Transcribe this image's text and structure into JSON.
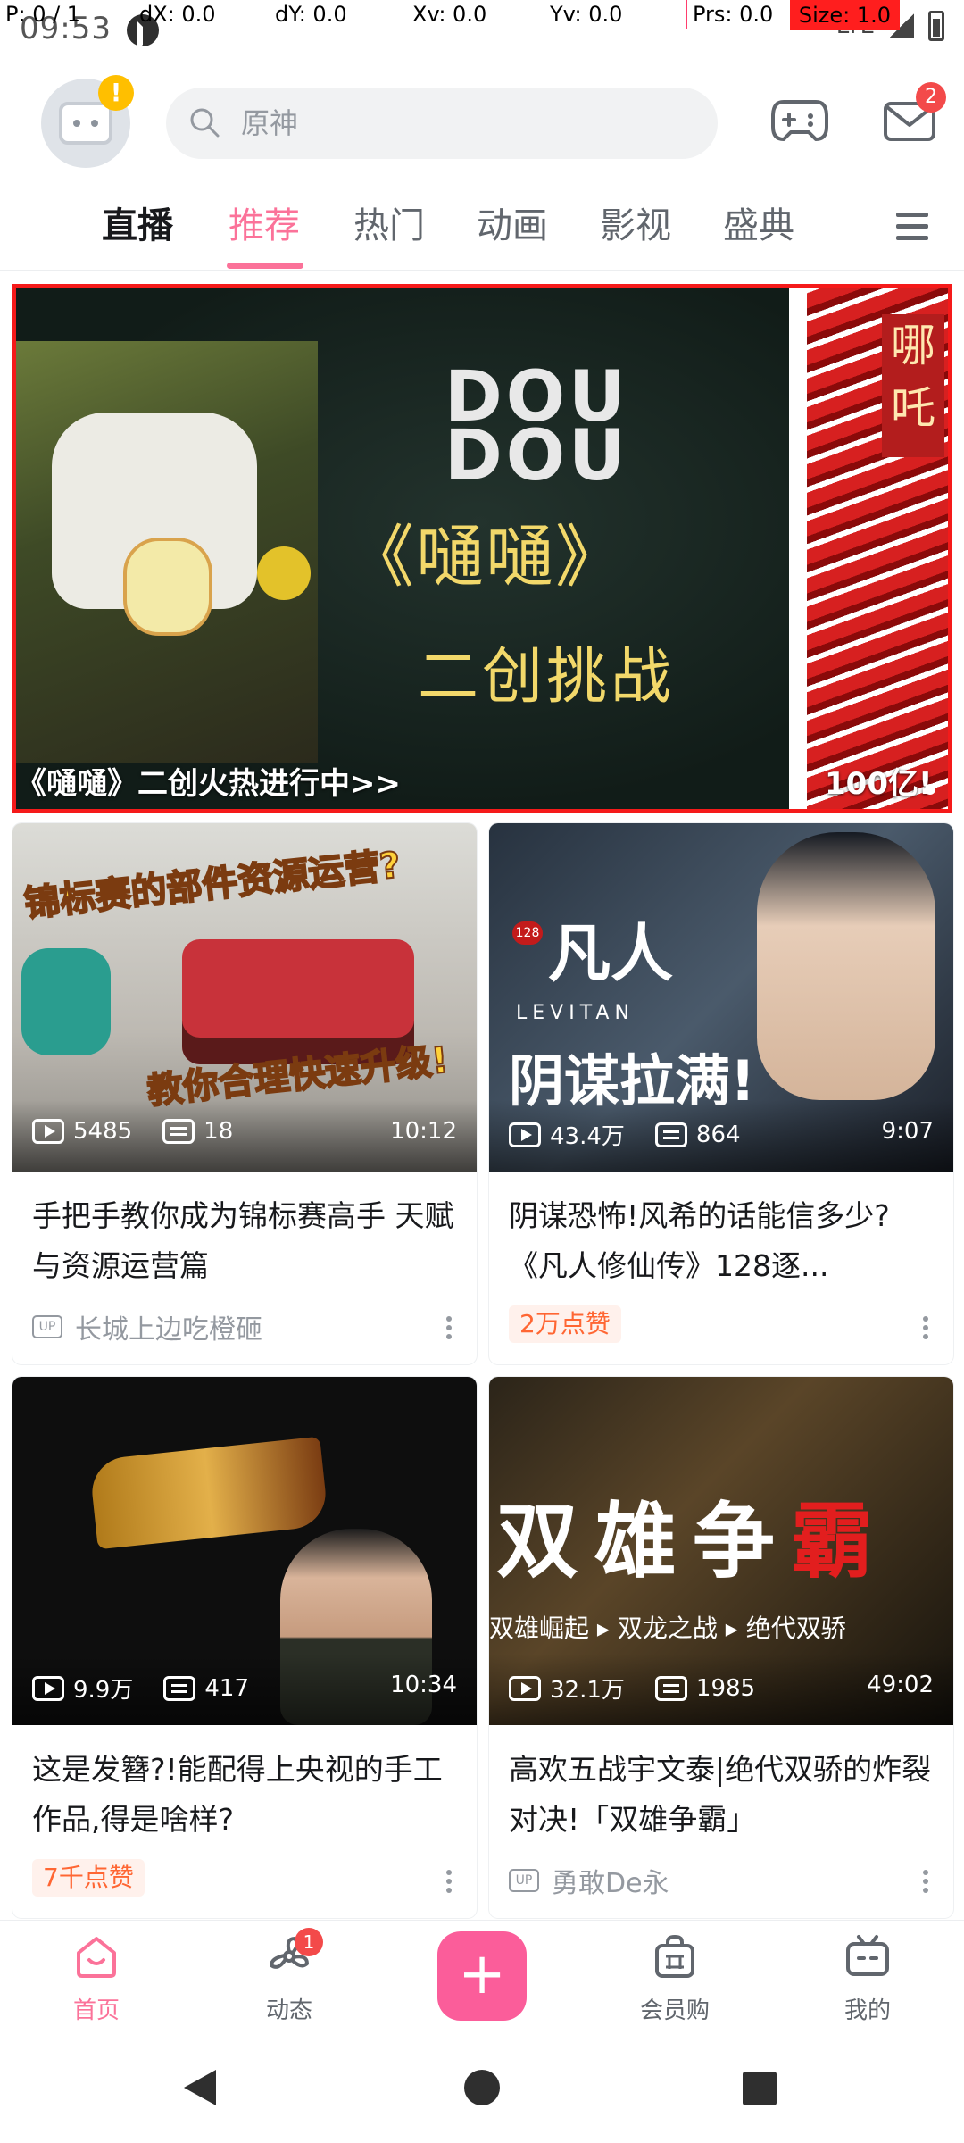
{
  "status": {
    "time": "09:53",
    "network": "LTE"
  },
  "debug_overlay": {
    "p": "P: 0 / 1",
    "dx": "dX: 0.0",
    "dy": "dY: 0.0",
    "xv": "Xv: 0.0",
    "yv": "Yv: 0.0",
    "prs": "Prs: 0.0",
    "size": "Size: 1.0"
  },
  "header": {
    "avatar_badge": "!",
    "search_placeholder": "原神",
    "mail_badge": "2"
  },
  "tabs": [
    {
      "label": "直播"
    },
    {
      "label": "推荐"
    },
    {
      "label": "热门"
    },
    {
      "label": "动画"
    },
    {
      "label": "影视"
    },
    {
      "label": "盛典"
    }
  ],
  "banner": {
    "logo_line1": "DOU",
    "logo_line2": "DOU",
    "art_title": "《嗵嗵》",
    "art_sub": "二创挑战",
    "caption": "《嗵嗵》二创火热进行中>>",
    "side_caption": "100亿!",
    "side_tag": "哪吒"
  },
  "cards": [
    {
      "thumb_text1": "锦标赛的部件资源运营?",
      "thumb_text2": "教你合理快速升级!",
      "views": "5485",
      "danmaku": "18",
      "duration": "10:12",
      "title": "手把手教你成为锦标赛高手 天赋与资源运营篇",
      "up_label": "UP",
      "author": "长城上边吃橙砸"
    },
    {
      "thumb_logo": "凡人",
      "thumb_ep": "128",
      "thumb_lev": "LEVITAN",
      "thumb_big": "阴谋拉满!",
      "views": "43.4万",
      "danmaku": "864",
      "duration": "9:07",
      "title": "阴谋恐怖!风希的话能信多少?《凡人修仙传》128逐...",
      "like_tag": "2万点赞"
    },
    {
      "views": "9.9万",
      "danmaku": "417",
      "duration": "10:34",
      "title": "这是发簪?!能配得上央视的手工作品,得是啥样?",
      "like_tag": "7千点赞"
    },
    {
      "thumb_big_a": "双雄争",
      "thumb_big_b": "霸",
      "thumb_sub": "双雄崛起 ▸ 双龙之战 ▸ 绝代双骄",
      "views": "32.1万",
      "danmaku": "1985",
      "duration": "49:02",
      "title": "高欢五战宇文泰|绝代双骄的炸裂对决!「双雄争霸」",
      "up_label": "UP",
      "author": "勇敢De永"
    }
  ],
  "bottom_nav": [
    {
      "label": "首页",
      "icon": "home-icon"
    },
    {
      "label": "动态",
      "icon": "fan-icon",
      "badge": "1"
    },
    {
      "label": "+",
      "icon": "plus-icon"
    },
    {
      "label": "会员购",
      "icon": "shopping-bag-icon"
    },
    {
      "label": "我的",
      "icon": "tv-icon"
    }
  ],
  "colors": {
    "accent": "#fb7299",
    "banner_border": "#f51a1a",
    "badge_red": "#f34a4a",
    "like_tag": "#ff6633"
  }
}
